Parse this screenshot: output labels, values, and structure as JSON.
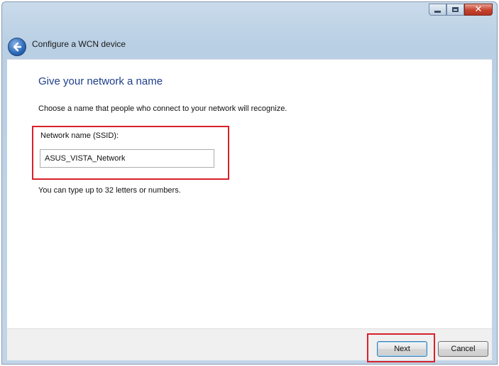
{
  "window": {
    "title": "Configure a WCN device",
    "caption_icons": [
      "minimize-icon",
      "maximize-icon",
      "close-icon"
    ],
    "back_icon": "back-arrow-icon"
  },
  "page": {
    "heading": "Give your network a name",
    "description": "Choose a name that people who connect to your network will recognize.",
    "field_label": "Network name (SSID):",
    "ssid_value": "ASUS_VISTA_Network",
    "hint": "You can type up to 32 letters or numbers."
  },
  "footer": {
    "next_label": "Next",
    "cancel_label": "Cancel"
  },
  "colors": {
    "highlight": "#d8212a",
    "heading": "#1e3e8a",
    "frame": "#c2d5e8"
  }
}
